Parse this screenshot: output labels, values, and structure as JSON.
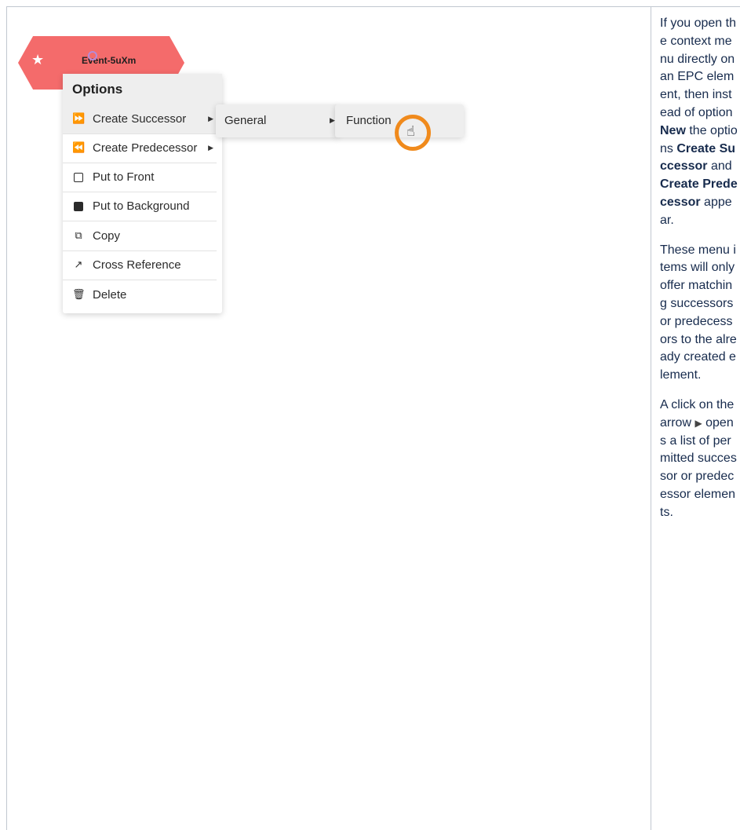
{
  "event": {
    "label": "Event-5uXm",
    "icon": "star-icon",
    "color": "#f46b6b"
  },
  "menu": {
    "title": "Options",
    "items": [
      {
        "label": "Create Successor",
        "icon": "fast-forward-icon",
        "has_submenu": true,
        "active": true
      },
      {
        "label": "Create Predecessor",
        "icon": "fast-rewind-icon",
        "has_submenu": true
      },
      {
        "label": "Put to Front",
        "icon": "square-outline-icon"
      },
      {
        "label": "Put to Background",
        "icon": "square-filled-icon"
      },
      {
        "label": "Copy",
        "icon": "copy-icon"
      },
      {
        "label": "Cross Reference",
        "icon": "external-link-icon"
      },
      {
        "label": "Delete",
        "icon": "trash-icon"
      }
    ]
  },
  "submenu": {
    "general_label": "General",
    "function_label": "Function"
  },
  "cursor": {
    "ring_color": "#f08a1c",
    "icon": "hand-pointer-icon"
  },
  "description": {
    "p1": {
      "t1": "If you open the context menu directly on an EPC element, then instead of option ",
      "b1": "New",
      "t2": " the options ",
      "b2": "Create Successor",
      "t3": " and ",
      "b3": "Create Predecessor",
      "t4": " appear."
    },
    "p2": "These menu items will only offer matching successors or predecessors to the already created element.",
    "p3": {
      "t1": "A click on the arrow ",
      "arrow_icon": "triangle-right-icon",
      "t2": " opens a list of permitted successor or predecessor elements."
    }
  }
}
